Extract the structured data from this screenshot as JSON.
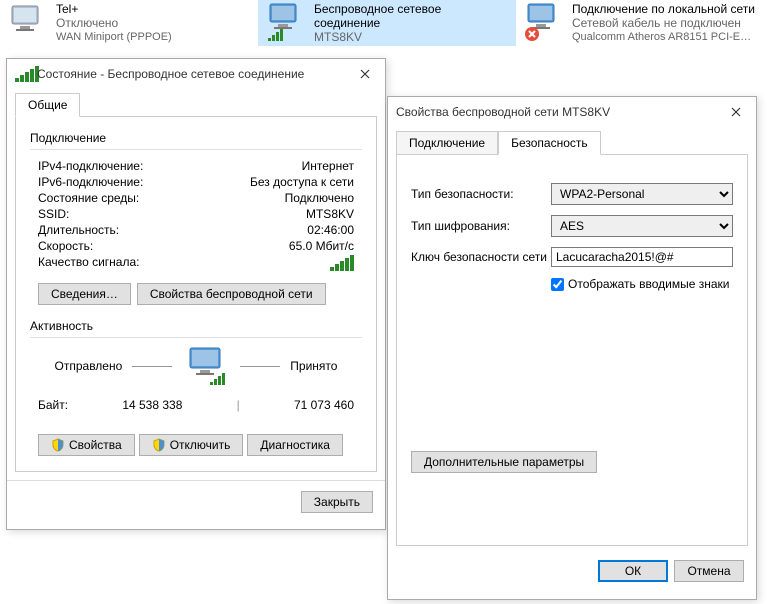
{
  "connections": [
    {
      "title": "Tel+",
      "status": "Отключено",
      "detail": "WAN Miniport (PPPOE)",
      "disabled": true
    },
    {
      "title": "Беспроводное сетевое соединение",
      "status": "MTS8KV",
      "detail": "",
      "selected": true
    },
    {
      "title": "Подключение по локальной сети",
      "status": "Сетевой кабель не подключен",
      "detail": "Qualcomm Atheros AR8151 PCI-E…",
      "error": true
    }
  ],
  "status_dialog": {
    "title": "Состояние - Беспроводное сетевое соединение",
    "tab": "Общие",
    "group_conn": "Подключение",
    "rows": {
      "ipv4_label": "IPv4-подключение:",
      "ipv4_value": "Интернет",
      "ipv6_label": "IPv6-подключение:",
      "ipv6_value": "Без доступа к сети",
      "media_label": "Состояние среды:",
      "media_value": "Подключено",
      "ssid_label": "SSID:",
      "ssid_value": "MTS8KV",
      "duration_label": "Длительность:",
      "duration_value": "02:46:00",
      "speed_label": "Скорость:",
      "speed_value": "65.0 Мбит/с",
      "signal_label": "Качество сигнала:"
    },
    "btn_details": "Сведения…",
    "btn_wireless_props": "Свойства беспроводной сети",
    "group_activity": "Активность",
    "activity": {
      "sent_label": "Отправлено",
      "recv_label": "Принято",
      "bytes_label": "Байт:",
      "sent_bytes": "14 538 338",
      "recv_bytes": "71 073 460"
    },
    "btn_properties": "Свойства",
    "btn_disconnect": "Отключить",
    "btn_diagnose": "Диагностика",
    "btn_close": "Закрыть"
  },
  "props_dialog": {
    "title": "Свойства беспроводной сети MTS8KV",
    "tab_connection": "Подключение",
    "tab_security": "Безопасность",
    "security_type_label": "Тип безопасности:",
    "security_type_value": "WPA2-Personal",
    "encryption_label": "Тип шифрования:",
    "encryption_value": "AES",
    "key_label": "Ключ безопасности сети",
    "key_value": "Lacucaracha2015!@#",
    "show_chars_label": "Отображать вводимые знаки",
    "btn_advanced": "Дополнительные параметры",
    "btn_ok": "ОК",
    "btn_cancel": "Отмена"
  }
}
